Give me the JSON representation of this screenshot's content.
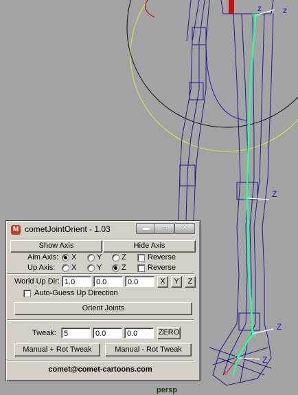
{
  "viewport": {
    "camera_label": "persp",
    "axis_z_label": "z",
    "axis_z_label_caps": "Z",
    "axis_x_label": "x"
  },
  "window": {
    "title": "cometJointOrient - 1.03",
    "icon": "maya-app-icon",
    "controls": {
      "minimize": "▬",
      "maximize": "▭",
      "close": "✕"
    }
  },
  "show_axis_label": "Show Axis",
  "hide_axis_label": "Hide Axis",
  "aim_axis": {
    "label": "Aim Axis:",
    "options": [
      "X",
      "Y",
      "Z"
    ],
    "selected": "X",
    "reverse_label": "Reverse",
    "reverse_checked": false
  },
  "up_axis": {
    "label": "Up  Axis:",
    "options": [
      "X",
      "Y",
      "Z"
    ],
    "selected": "Z",
    "reverse_label": "Reverse",
    "reverse_checked": false
  },
  "world_up_dir": {
    "label": "World Up Dir:",
    "values": [
      "1.0",
      "0.0",
      "0.0"
    ],
    "buttons": [
      "X",
      "Y",
      "Z"
    ]
  },
  "auto_guess_label": "Auto-Guess Up Direction",
  "auto_guess_checked": false,
  "orient_joints_label": "Orient Joints",
  "tweak": {
    "label": "Tweak:",
    "values": [
      "5",
      "0.0",
      "0.0"
    ],
    "zero_label": "ZERO"
  },
  "manual_plus_label": "Manual + Rot Tweak",
  "manual_minus_label": "Manual - Rot Tweak",
  "email": "comet@comet-cartoons.com",
  "colors": {
    "bone": "#2bff9a",
    "mesh": "#1a1a8c",
    "ring_yellow": "#e8e83a",
    "ring_black": "#111111"
  }
}
